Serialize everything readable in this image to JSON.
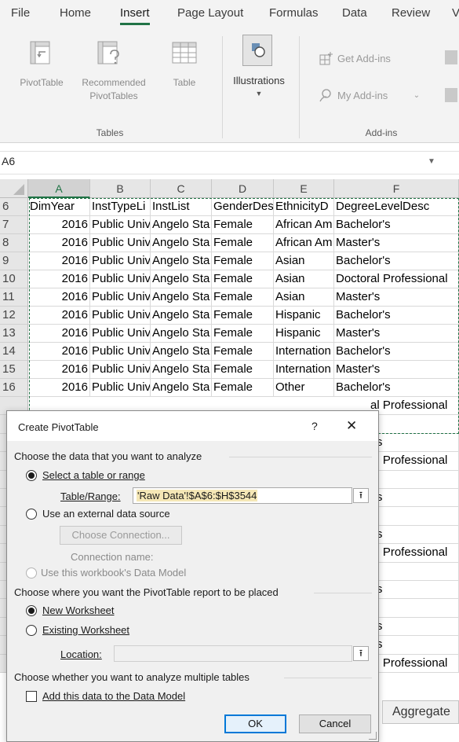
{
  "ribbon": {
    "tabs": [
      "File",
      "Home",
      "Insert",
      "Page Layout",
      "Formulas",
      "Data",
      "Review",
      "V"
    ],
    "active_tab": "Insert",
    "tables_group": {
      "label": "Tables",
      "pivot": "PivotTable",
      "recommended_line1": "Recommended",
      "recommended_line2": "PivotTables",
      "table": "Table"
    },
    "illustrations": "Illustrations",
    "addins_group": {
      "label": "Add-ins",
      "get": "Get Add-ins",
      "my": "My Add-ins"
    }
  },
  "namebox": "A6",
  "grid": {
    "columns": [
      "A",
      "B",
      "C",
      "D",
      "E",
      "F"
    ],
    "header_row": {
      "num": "6",
      "cells": [
        "DimYear",
        "InstTypeLi",
        "InstList",
        "GenderDes",
        "EthnicityD",
        "DegreeLevelDesc"
      ]
    },
    "rows": [
      {
        "num": "7",
        "cells": [
          "2016",
          "Public Univ",
          "Angelo Sta",
          "Female",
          "African Am",
          "Bachelor's"
        ]
      },
      {
        "num": "8",
        "cells": [
          "2016",
          "Public Univ",
          "Angelo Sta",
          "Female",
          "African Am",
          "Master's"
        ]
      },
      {
        "num": "9",
        "cells": [
          "2016",
          "Public Univ",
          "Angelo Sta",
          "Female",
          "Asian",
          "Bachelor's"
        ]
      },
      {
        "num": "10",
        "cells": [
          "2016",
          "Public Univ",
          "Angelo Sta",
          "Female",
          "Asian",
          "Doctoral Professional"
        ]
      },
      {
        "num": "11",
        "cells": [
          "2016",
          "Public Univ",
          "Angelo Sta",
          "Female",
          "Asian",
          "Master's"
        ]
      },
      {
        "num": "12",
        "cells": [
          "2016",
          "Public Univ",
          "Angelo Sta",
          "Female",
          "Hispanic",
          "Bachelor's"
        ]
      },
      {
        "num": "13",
        "cells": [
          "2016",
          "Public Univ",
          "Angelo Sta",
          "Female",
          "Hispanic",
          "Master's"
        ]
      },
      {
        "num": "14",
        "cells": [
          "2016",
          "Public Univ",
          "Angelo Sta",
          "Female",
          "Internation",
          "Bachelor's"
        ]
      },
      {
        "num": "15",
        "cells": [
          "2016",
          "Public Univ",
          "Angelo Sta",
          "Female",
          "Internation",
          "Master's"
        ]
      },
      {
        "num": "16",
        "cells": [
          "2016",
          "Public Univ",
          "Angelo Sta",
          "Female",
          "Other",
          "Bachelor's"
        ]
      }
    ],
    "right_fragments": [
      "al Professional",
      "s",
      "r's",
      "al Professional",
      "s",
      "r's",
      "s",
      "r's",
      "al Professional",
      "s",
      "r's",
      "s",
      "r's",
      "r's",
      "al Professional"
    ]
  },
  "dialog": {
    "title": "Create PivotTable",
    "help": "?",
    "close": "✕",
    "section1": "Choose the data that you want to analyze",
    "opt_select_range": "Select a table or range",
    "table_range_label": "Table/Range:",
    "table_range_value": "'Raw Data'!$A$6:$H$3544",
    "opt_external": "Use an external data source",
    "choose_connection": "Choose Connection...",
    "connection_name_label": "Connection name:",
    "opt_data_model": "Use this workbook's Data Model",
    "section2": "Choose where you want the PivotTable report to be placed",
    "opt_new_ws": "New Worksheet",
    "opt_existing_ws": "Existing Worksheet",
    "location_label": "Location:",
    "location_value": "",
    "section3": "Choose whether you want to analyze multiple tables",
    "add_to_model": "Add this data to the Data Model",
    "ok": "OK",
    "cancel": "Cancel"
  },
  "aggregate_label": "Aggregate",
  "accent_green": "#217346"
}
